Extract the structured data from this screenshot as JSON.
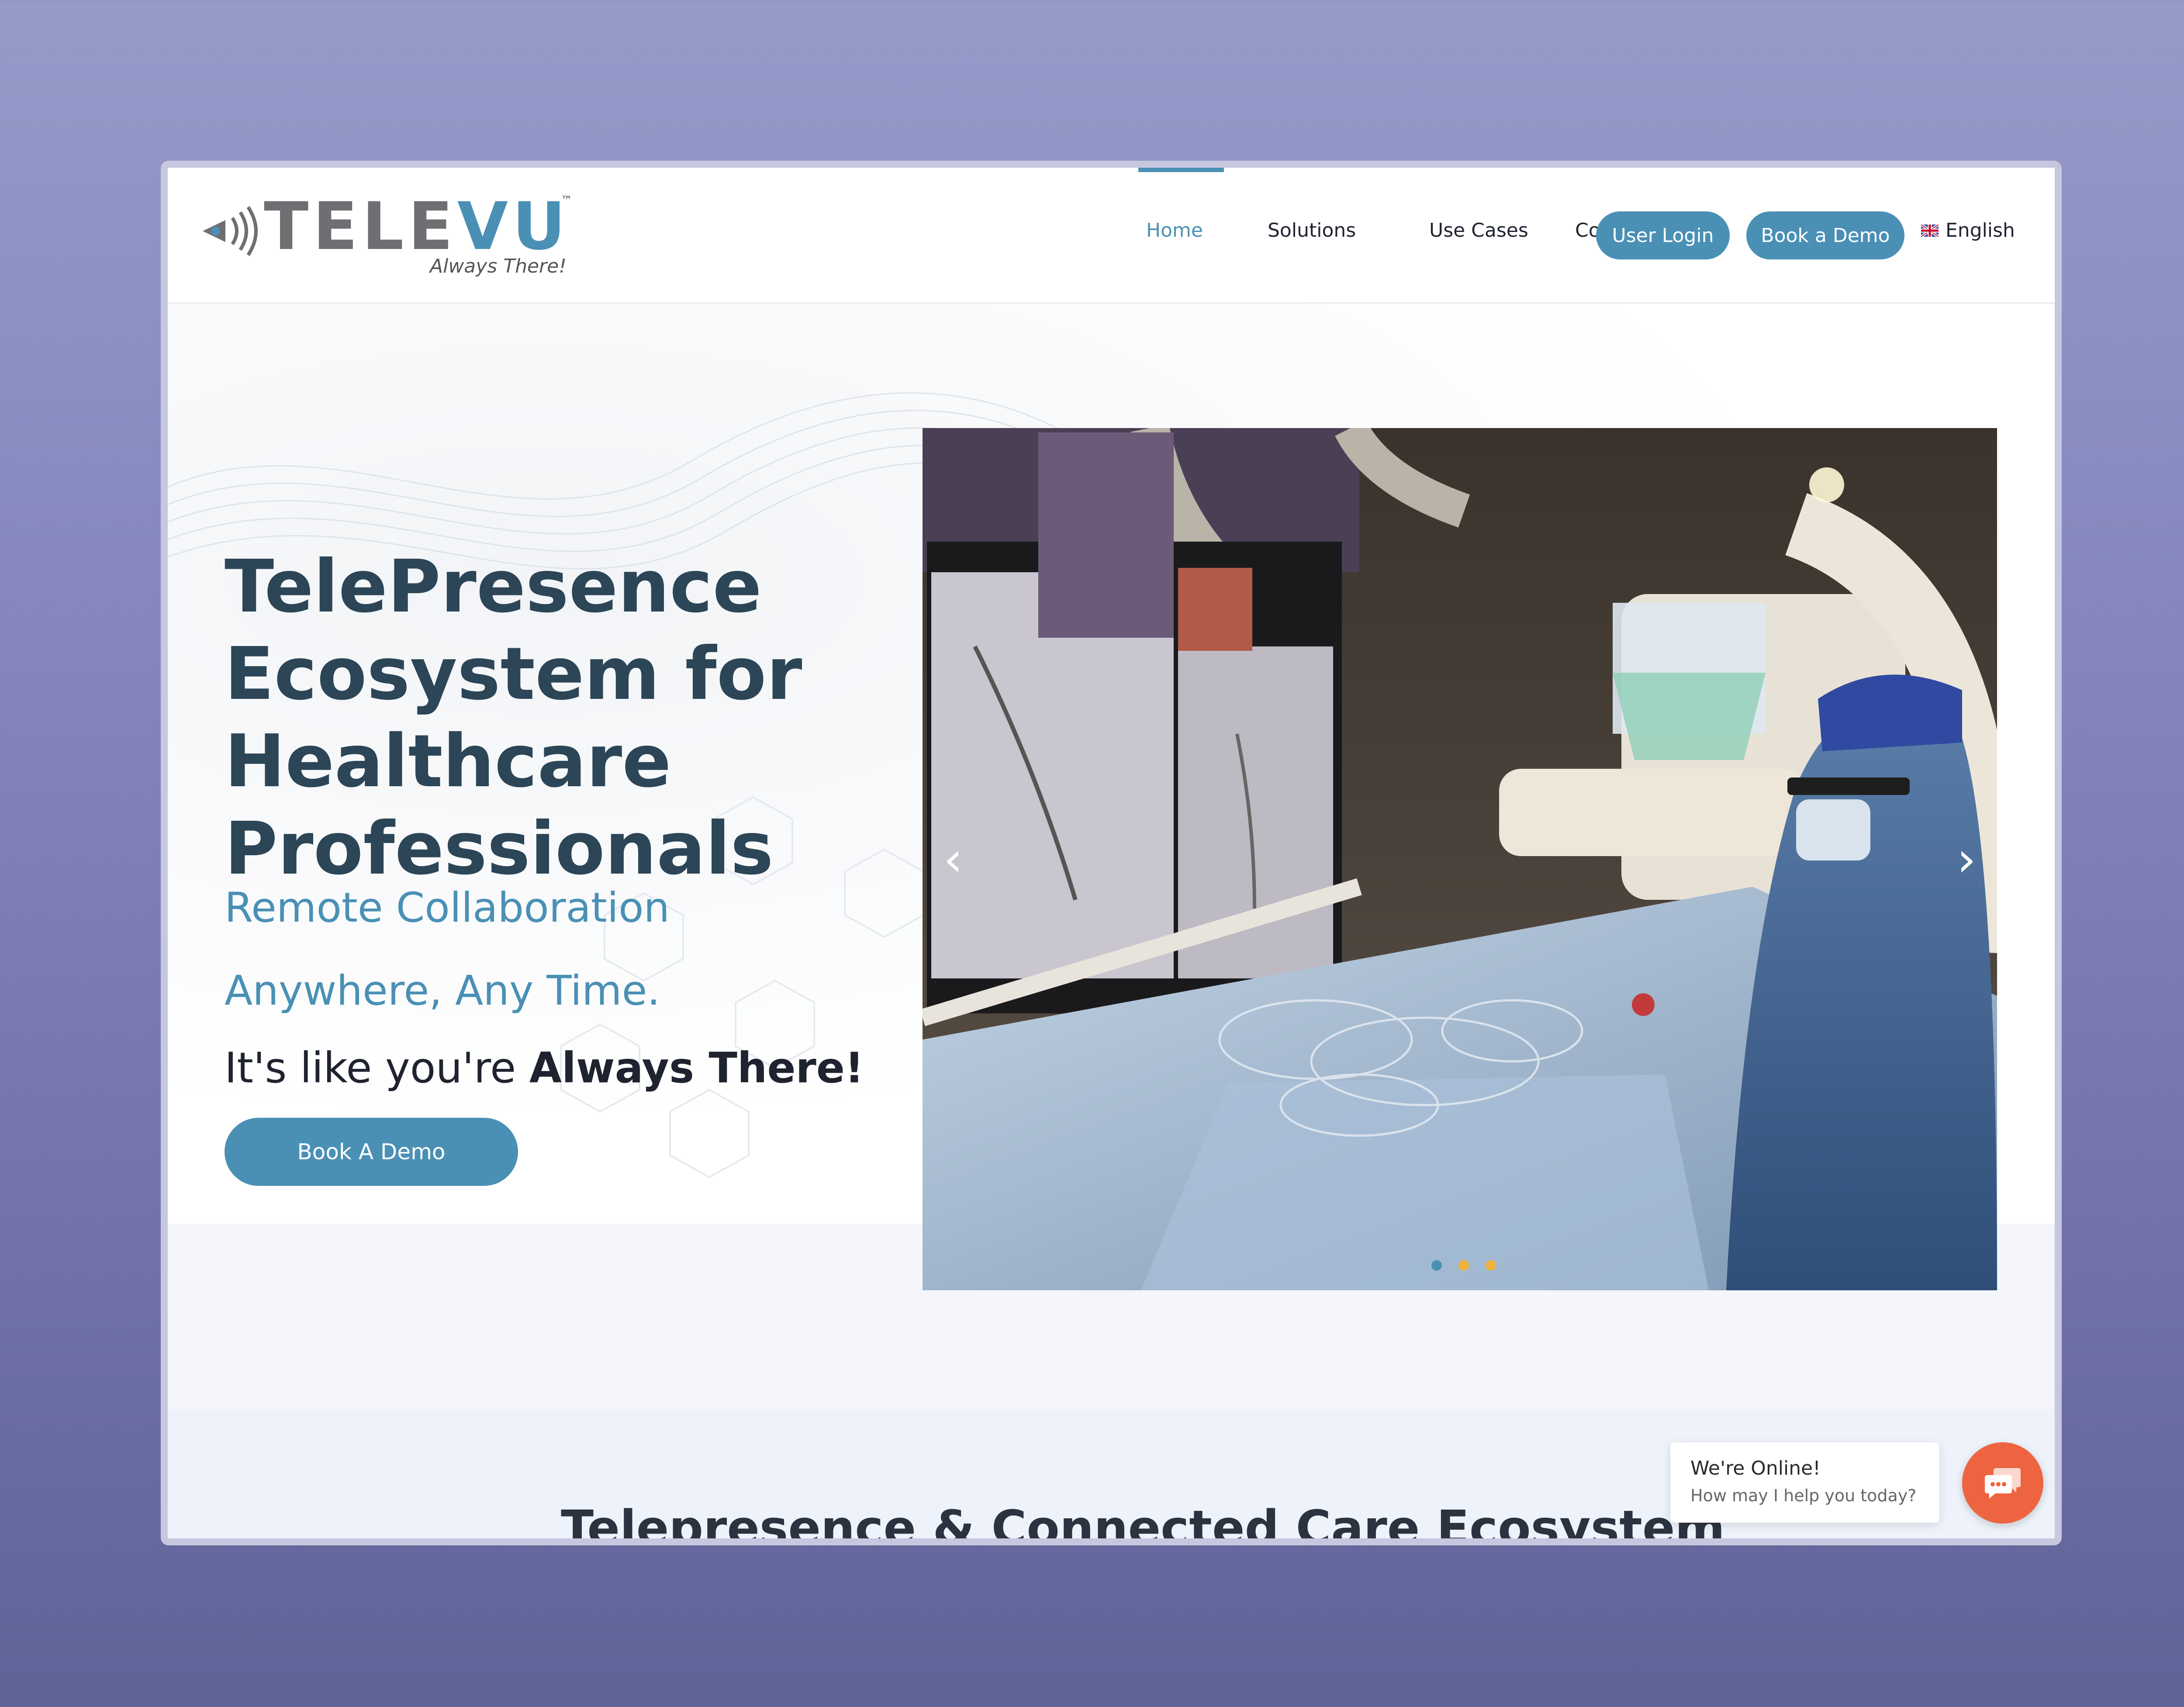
{
  "brand": {
    "name_primary": "TELE",
    "name_accent": "VU",
    "trademark": "™",
    "tagline": "Always There!"
  },
  "nav": {
    "items": [
      {
        "label": "Home",
        "active": true
      },
      {
        "label": "Solutions"
      },
      {
        "label": "Use Cases"
      },
      {
        "label": "Contact"
      }
    ],
    "user_login": "User Login",
    "book_demo": "Book a Demo",
    "language": "English"
  },
  "hero": {
    "title": "TelePresence Ecosystem for Healthcare Professionals",
    "subtitle_1": "Remote Collaboration",
    "subtitle_2": "Anywhere, Any Time.",
    "tagline_prefix": "It's like you're ",
    "tagline_bold": "Always There!",
    "cta": "Book A Demo",
    "slider": {
      "prev_icon": "chevron-left-icon",
      "next_icon": "chevron-right-icon",
      "dots": [
        {
          "color": "#4a90b5",
          "active": true
        },
        {
          "color": "#f0b33c"
        },
        {
          "color": "#f0b33c"
        }
      ]
    }
  },
  "section": {
    "title": "Telepresence & Connected Care Ecosystem"
  },
  "chat": {
    "title": "We're Online!",
    "message": "How may I help you today?",
    "icon": "chat-bubble-icon"
  },
  "colors": {
    "accent": "#4a90b5",
    "heading": "#2c4657",
    "chat": "#ee6440",
    "background": "#8a8cc3"
  }
}
